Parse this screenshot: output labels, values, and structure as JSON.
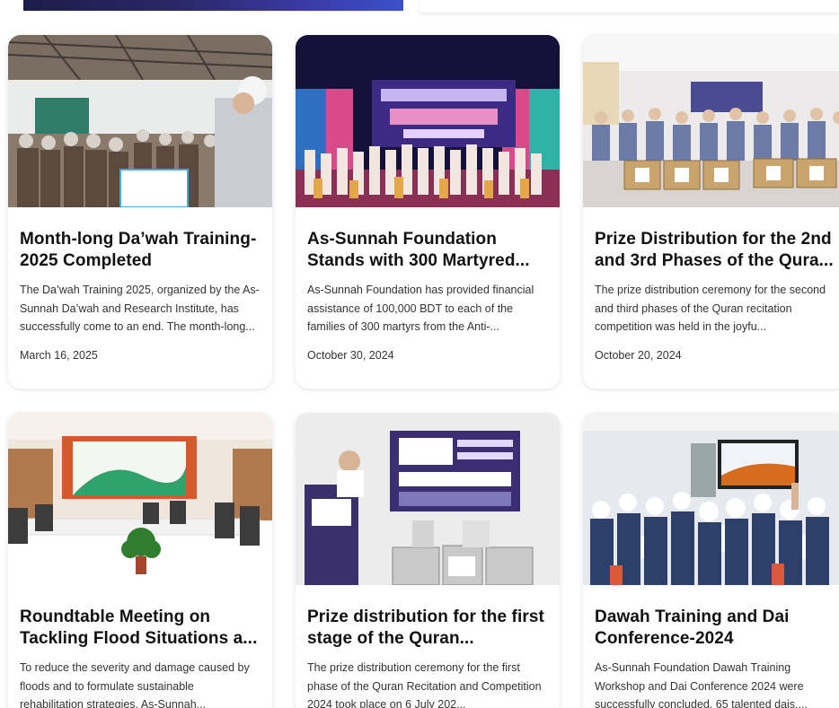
{
  "colors": {
    "card_bg": "#ffffff",
    "title": "#111111",
    "text": "#333333",
    "top_banner": "#2a2766"
  },
  "cards": [
    {
      "title": "Month-long Da’wah Training-2025 Completed",
      "excerpt": "The Da’wah Training 2025, organized by the As-Sunnah Da’wah and Research Institute, has successfully come to an end. The month-long...",
      "date": "March 16, 2025",
      "image": "training-hall-photo"
    },
    {
      "title": "As-Sunnah Foundation Stands with 300 Martyred...",
      "excerpt": "As-Sunnah Foundation has provided financial assistance of 100,000 BDT to each of the families of 300 martyrs from the Anti-...",
      "date": "October 30, 2024",
      "image": "stage-group-photo"
    },
    {
      "title": "Prize Distribution for the 2nd and 3rd Phases of the Qura...",
      "excerpt": "The prize distribution ceremony for the second and third phases of the Quran recitation competition was held in the joyfu...",
      "date": "October 20, 2024",
      "image": "prize-boxes-photo"
    },
    {
      "title": "Roundtable Meeting on Tackling Flood Situations a...",
      "excerpt": "To reduce the severity and damage caused by floods and to formulate sustainable rehabilitation strategies, As-Sunnah...",
      "date": "",
      "image": "roundtable-photo"
    },
    {
      "title": "Prize distribution for the first stage of the Quran...",
      "excerpt": "The prize distribution ceremony for the first phase of the Quran Recitation and Competition 2024 took place on 6 July 202...",
      "date": "",
      "image": "prize-stage-photo"
    },
    {
      "title": "Dawah Training and Dai Conference-2024",
      "excerpt": "As-Sunnah Foundation Dawah Training Workshop and Dai Conference 2024 were successfully concluded. 65 talented dais,...",
      "date": "",
      "image": "conference-photo"
    }
  ]
}
